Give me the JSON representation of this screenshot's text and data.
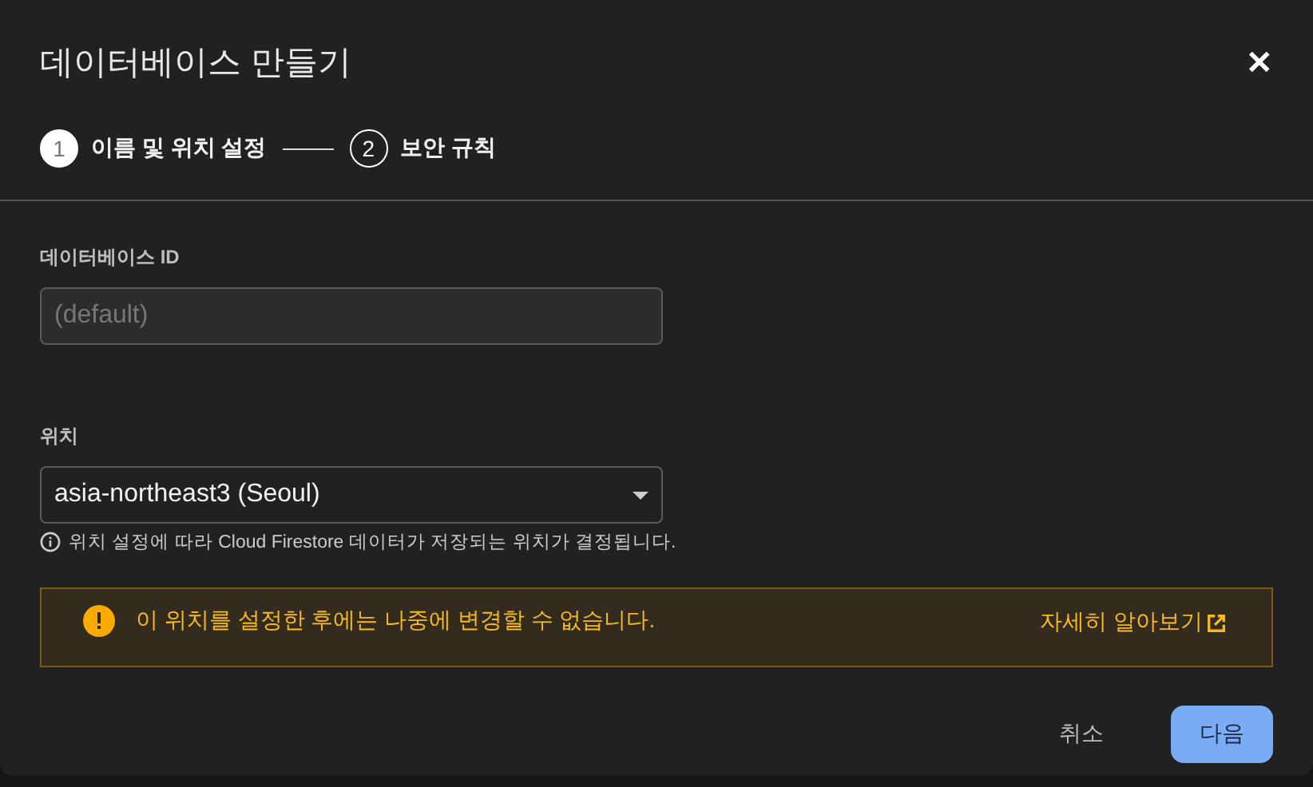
{
  "dialog": {
    "title": "데이터베이스 만들기",
    "close_icon": "✕"
  },
  "steps": [
    {
      "number": "1",
      "label": "이름 및 위치 설정",
      "selected": true
    },
    {
      "number": "2",
      "label": "보안 규칙",
      "selected": false
    }
  ],
  "database_id": {
    "label": "데이터베이스 ID",
    "placeholder": "(default)"
  },
  "location": {
    "label": "위치",
    "value": "asia-northeast3 (Seoul)",
    "help": "위치 설정에 따라 Cloud Firestore 데이터가 저장되는 위치가 결정됩니다."
  },
  "warning": {
    "message": "이 위치를 설정한 후에는 나중에 변경할 수 없습니다.",
    "link": "자세히 알아보기"
  },
  "buttons": [
    {
      "label": "취소",
      "kind": "text"
    },
    {
      "label": "다음",
      "kind": "primary"
    }
  ]
}
